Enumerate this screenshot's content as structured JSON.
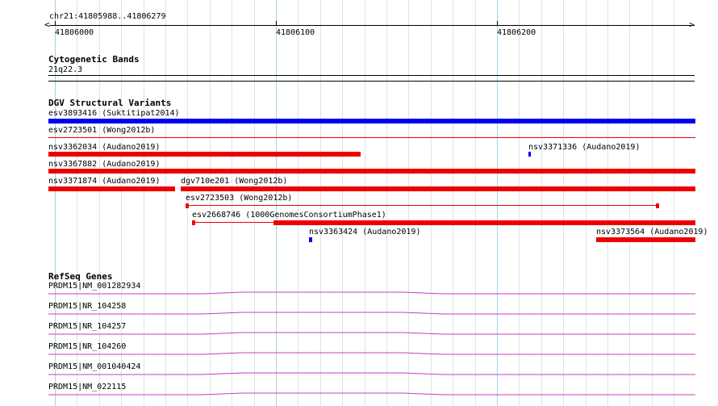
{
  "colors": {
    "grid_major": "#a6d2e6",
    "grid_minor": "#cfe8f3",
    "dgv_blue": "#0000ee",
    "dgv_red": "#ee0000",
    "refseq": "#c040c0"
  },
  "ruler": {
    "region": "chr21:41805988..41806279",
    "ticks": [
      "41806000",
      "41806100",
      "41806200"
    ]
  },
  "tracks": {
    "cytoband": {
      "title": "Cytogenetic Bands",
      "label": "21q22.3"
    },
    "dgv": {
      "title": "DGV Structural Variants",
      "features": [
        {
          "label": "esv3893416 (Suktitipat2014)",
          "color": "blue",
          "style": "thick"
        },
        {
          "label": "esv2723501 (Wong2012b)",
          "color": "red",
          "style": "thin"
        },
        {
          "label": "nsv3362034 (Audano2019)",
          "color": "red",
          "style": "thick"
        },
        {
          "label": "nsv3371336 (Audano2019)",
          "color": "blue",
          "style": "dot"
        },
        {
          "label": "nsv3367882 (Audano2019)",
          "color": "red",
          "style": "thick"
        },
        {
          "label": "nsv3371874 (Audano2019)",
          "color": "red",
          "style": "thick"
        },
        {
          "label": "dgv710e201 (Wong2012b)",
          "color": "red",
          "style": "thick"
        },
        {
          "label": "esv2723503 (Wong2012b)",
          "color": "red",
          "style": "connector"
        },
        {
          "label": "esv2668746 (1000GenomesConsortiumPhase1)",
          "color": "red",
          "style": "connector-thick"
        },
        {
          "label": "nsv3363424 (Audano2019)",
          "color": "blue",
          "style": "dot"
        },
        {
          "label": "nsv3373564 (Audano2019)",
          "color": "red",
          "style": "thick"
        }
      ]
    },
    "refseq": {
      "title": "RefSeq Genes",
      "genes": [
        "PRDM15|NM_001282934",
        "PRDM15|NR_104258",
        "PRDM15|NR_104257",
        "PRDM15|NR_104260",
        "PRDM15|NM_001040424",
        "PRDM15|NM_022115"
      ]
    }
  }
}
